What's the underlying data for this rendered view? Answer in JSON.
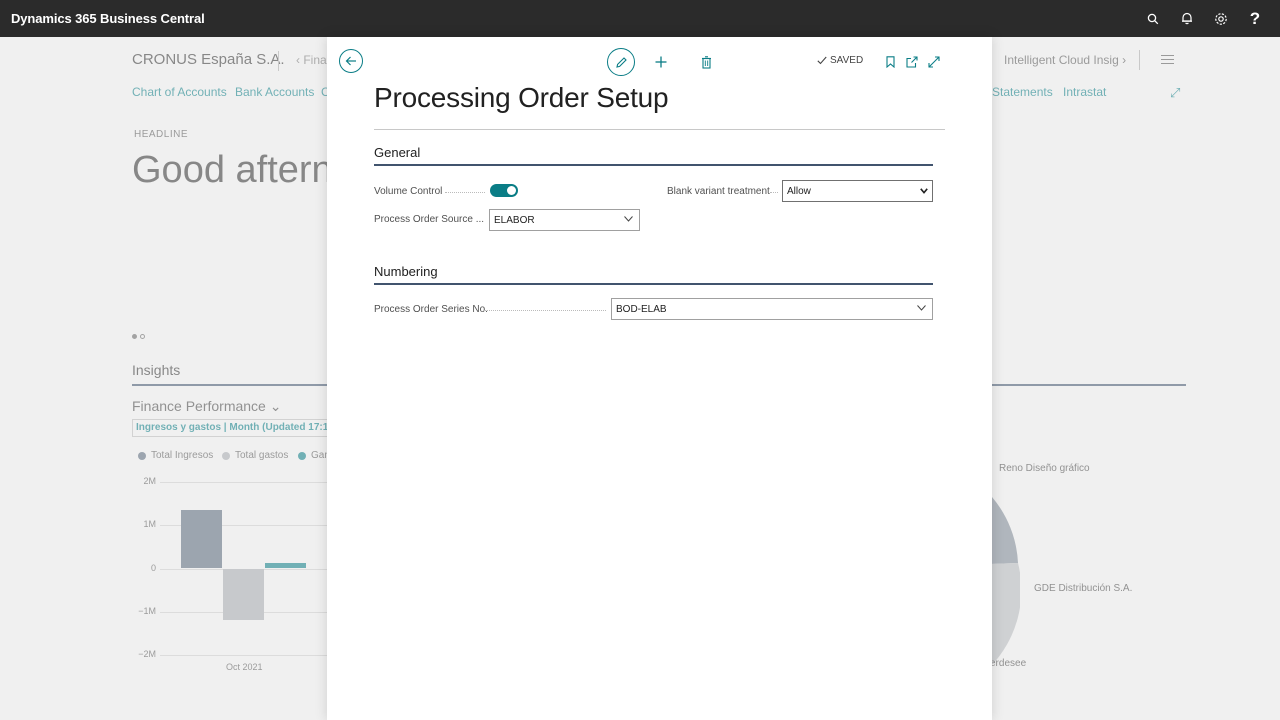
{
  "appbar": {
    "title": "Dynamics 365 Business Central",
    "icons": [
      "search-icon",
      "bell-icon",
      "gear-icon",
      "help-icon"
    ],
    "help_label": "?"
  },
  "background": {
    "company": "CRONUS España S.A.",
    "breadcrumb_fin": "Fina",
    "breadcrumb_right": "Intelligent Cloud Insig",
    "nav_links": [
      "Chart of Accounts",
      "Bank Accounts",
      "C",
      "Statements",
      "Intrastat"
    ],
    "headline_label": "HEADLINE",
    "greeting": "Good afterno",
    "insights": "Insights",
    "finance_performance": "Finance Performance",
    "chart_subtitle": "Ingresos y gastos | Month (Updated 17:10:",
    "chart_data": {
      "type": "bar",
      "categories": [
        "Oct 2021"
      ],
      "series": [
        {
          "name": "Total Ingresos",
          "values": [
            1.35
          ]
        },
        {
          "name": "Total gastos",
          "values": [
            -1.2
          ]
        },
        {
          "name": "Gan",
          "values": [
            0.12
          ]
        }
      ],
      "ylabel": "",
      "yticks": [
        "2M",
        "1M",
        "0",
        "−1M",
        "−2M"
      ],
      "ylim": [
        -2,
        2
      ]
    },
    "pie_labels": [
      "Reno Diseño gráfico",
      "GDE Distribución S.A.",
      "erdesee"
    ],
    "colors": {
      "ingresos": "#58687a",
      "gastos": "#a7abb0",
      "gan": "#0a7d86"
    }
  },
  "modal": {
    "title": "Processing Order Setup",
    "saved_label": "SAVED",
    "toolbar_icons": [
      "back-arrow-icon",
      "edit-icon",
      "plus-icon",
      "delete-icon",
      "check-icon",
      "bookmark-icon",
      "open-new-window-icon",
      "expand-icon"
    ],
    "general": {
      "heading": "General",
      "volume_control_label": "Volume Control",
      "volume_control_value": true,
      "process_order_source_label": "Process Order Source ...",
      "process_order_source_value": "ELABOR",
      "blank_variant_label": "Blank variant treatment",
      "blank_variant_value": "Allow"
    },
    "numbering": {
      "heading": "Numbering",
      "series_label": "Process Order Series No.",
      "series_value": "BOD-ELAB"
    },
    "accent_color": "#0a7d86"
  }
}
